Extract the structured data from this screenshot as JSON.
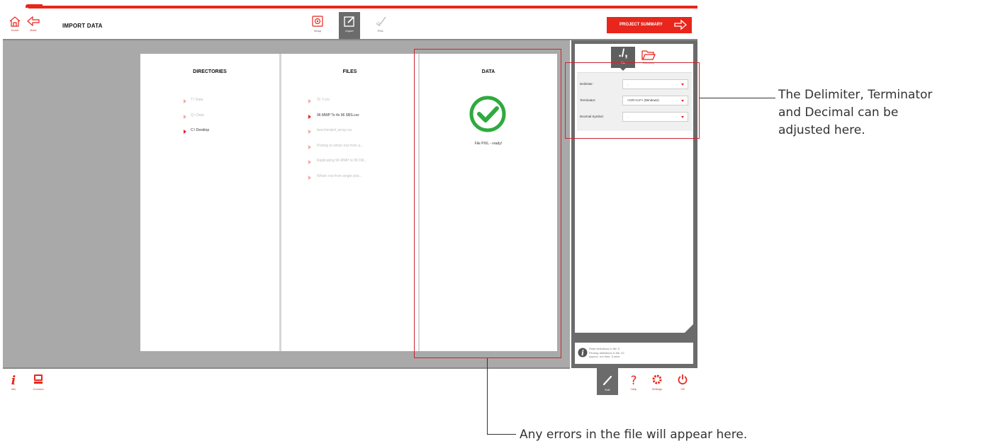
{
  "header": {
    "home_label": "Home",
    "back_label": "Back",
    "title": "IMPORT DATA",
    "steps": [
      {
        "label": "Setup"
      },
      {
        "label": "Import"
      },
      {
        "label": "PIXL"
      }
    ],
    "project_summary_label": "PROJECT SUMMARY"
  },
  "directories": {
    "title": "DIRECTORIES",
    "items": [
      "T:\\ Data",
      "Q:\\ Data",
      "C:\\ Desktop"
    ],
    "active_index": 2
  },
  "files": {
    "title": "FILES",
    "items": [
      "To T.csv",
      "96 MWP To 4x 96 SBS.csv",
      "benchmrpixl_array.csv",
      "Picking to whole row from a...",
      "Replicating 96 MWP to 96 Dill...",
      "Whole row from single pick..."
    ],
    "active_index": 1
  },
  "data_panel": {
    "title": "DATA",
    "status_text": "File PIXL - ready!"
  },
  "sidebar": {
    "tabs": [
      {
        "glyph": "./,",
        "label": "File"
      },
      {
        "label": "Directory"
      }
    ],
    "fields": [
      {
        "label": "Delimiter:",
        "value": ","
      },
      {
        "label": "Terminator:",
        "value": "<CR><LF> (Windows)"
      },
      {
        "label": "Decimal Symbol:",
        "value": "."
      }
    ],
    "info_lines": [
      "Plate definitions in file: 5",
      "Pinning definitions in file: 22",
      "Approx. run time: 3 mins"
    ]
  },
  "footer": {
    "info_label": "Info",
    "connect_label": "Connect",
    "edit_label": "Edit",
    "help_label": "Help",
    "settings_label": "Settings",
    "off_label": "Off"
  },
  "annotations": {
    "right": [
      "The Delimiter, Terminator",
      "and Decimal can be",
      "adjusted here."
    ],
    "bottom": "Any errors in the file will appear here."
  },
  "colors": {
    "accent": "#e8261c",
    "success": "#2eaa3e",
    "panel_gray": "#a9a9a9",
    "dark_gray": "#6b6b6b",
    "annotation_red": "#c9252f"
  },
  "icons": [
    "home-icon",
    "back-arrow-icon",
    "setup-icon",
    "import-icon",
    "pixl-icon",
    "forward-arrow-icon",
    "info-icon",
    "connect-icon",
    "file-tab-icon",
    "folder-icon",
    "check-icon",
    "pencil-icon",
    "help-icon",
    "gear-icon",
    "power-icon"
  ]
}
